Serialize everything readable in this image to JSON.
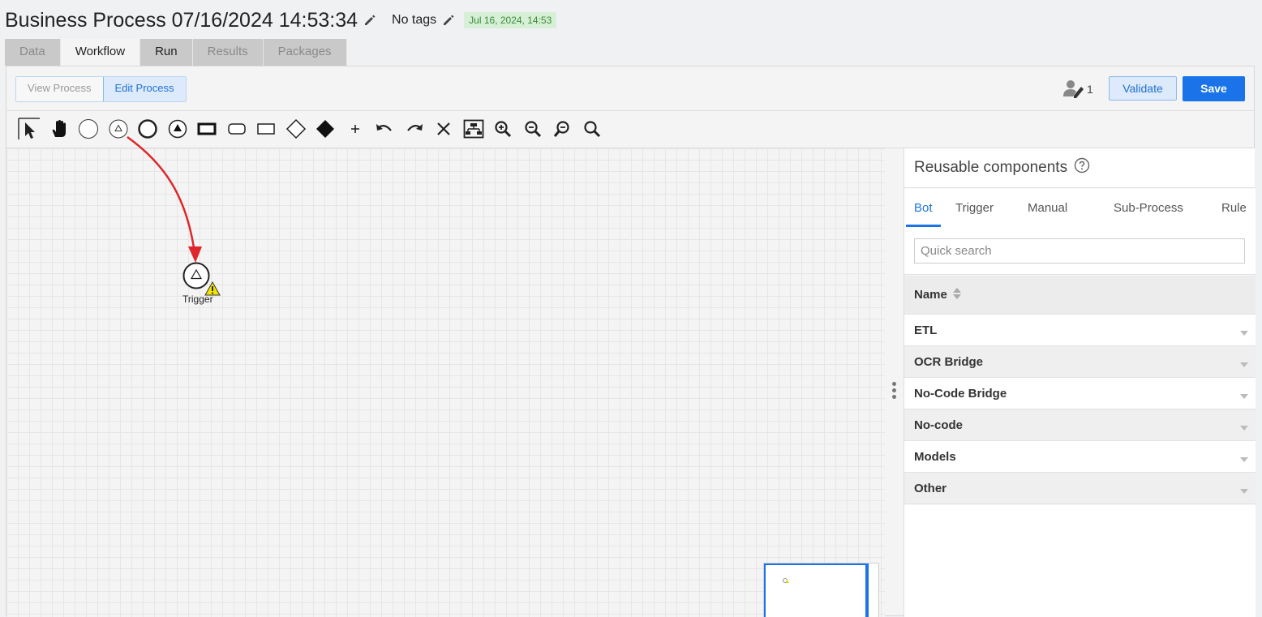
{
  "header": {
    "title": "Business Process 07/16/2024 14:53:34",
    "tags": "No tags",
    "date_badge": "Jul 16, 2024, 14:53"
  },
  "tabs": [
    {
      "label": "Data",
      "state": "disabled"
    },
    {
      "label": "Workflow",
      "state": "active"
    },
    {
      "label": "Run",
      "state": "enabled"
    },
    {
      "label": "Results",
      "state": "disabled"
    },
    {
      "label": "Packages",
      "state": "disabled"
    }
  ],
  "mode": {
    "view_label": "View Process",
    "edit_label": "Edit Process"
  },
  "actions": {
    "editors_count": "1",
    "validate_label": "Validate",
    "save_label": "Save"
  },
  "toolbar_icons": [
    "pointer-icon",
    "hand-icon",
    "start-event-icon",
    "trigger-event-icon",
    "end-event-icon",
    "end-event-filled-icon",
    "task-icon",
    "rounded-task-icon",
    "subprocess-icon",
    "gateway-icon",
    "filled-gateway-icon",
    "add-icon",
    "undo-icon",
    "redo-icon",
    "delete-icon",
    "auto-layout-icon",
    "zoom-in-icon",
    "zoom-out-icon",
    "zoom-reset-icon",
    "zoom-fit-icon"
  ],
  "canvas": {
    "node_label": "Trigger"
  },
  "side_panel": {
    "title": "Reusable components",
    "tabs": [
      "Bot",
      "Trigger",
      "Manual",
      "Sub-Process",
      "Rule"
    ],
    "active_tab": "Bot",
    "search_placeholder": "Quick search",
    "column_header": "Name",
    "items": [
      "ETL",
      "OCR Bridge",
      "No-Code Bridge",
      "No-code",
      "Models",
      "Other"
    ]
  },
  "colors": {
    "accent": "#1a73e8",
    "annotation_arrow": "#e0262a",
    "badge_bg": "#d6efd6",
    "badge_text": "#3b8a3b"
  }
}
